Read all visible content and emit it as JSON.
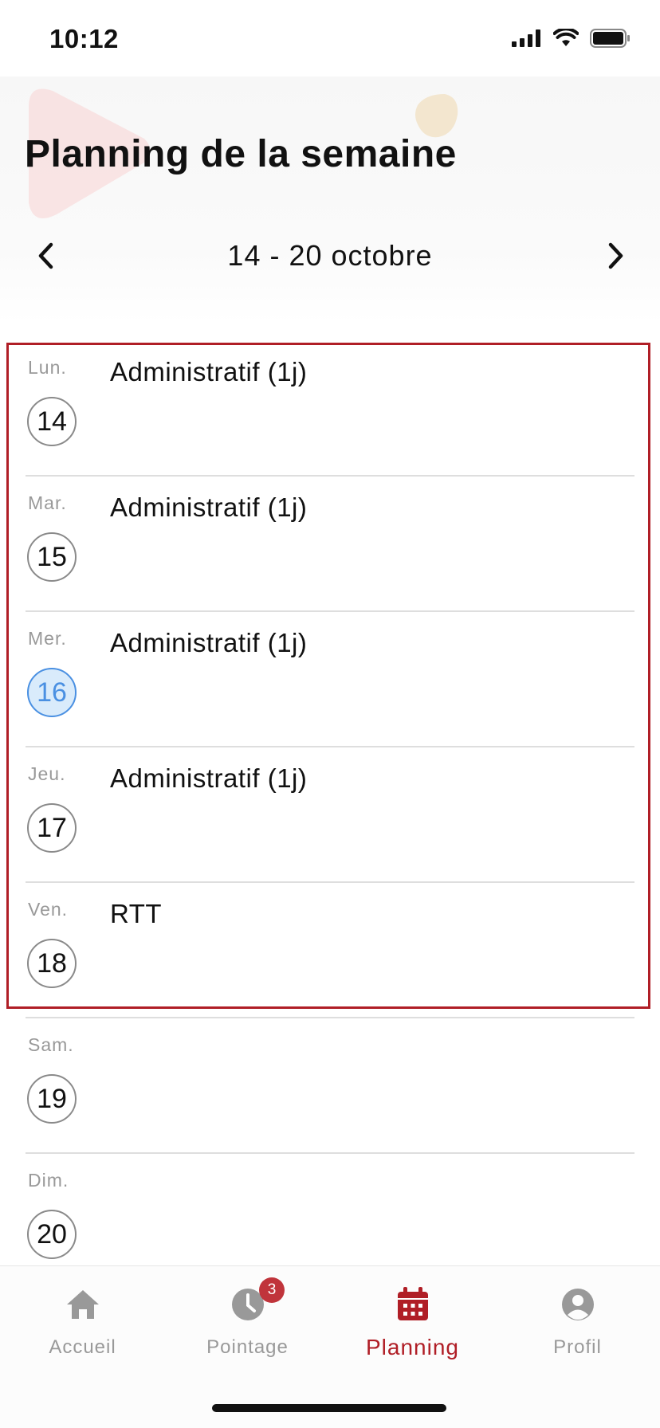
{
  "status_bar": {
    "time": "10:12"
  },
  "header": {
    "title": "Planning de la semaine",
    "week_range": "14 - 20 octobre"
  },
  "days": [
    {
      "abbr": "Lun.",
      "number": "14",
      "event": "Administratif (1j)",
      "today": false
    },
    {
      "abbr": "Mar.",
      "number": "15",
      "event": "Administratif (1j)",
      "today": false
    },
    {
      "abbr": "Mer.",
      "number": "16",
      "event": "Administratif (1j)",
      "today": true
    },
    {
      "abbr": "Jeu.",
      "number": "17",
      "event": "Administratif (1j)",
      "today": false
    },
    {
      "abbr": "Ven.",
      "number": "18",
      "event": "RTT",
      "today": false
    },
    {
      "abbr": "Sam.",
      "number": "19",
      "event": "",
      "today": false
    },
    {
      "abbr": "Dim.",
      "number": "20",
      "event": "",
      "today": false
    }
  ],
  "tabs": [
    {
      "label": "Accueil",
      "icon": "home-icon",
      "active": false
    },
    {
      "label": "Pointage",
      "icon": "clock-icon",
      "active": false,
      "badge": "3"
    },
    {
      "label": "Planning",
      "icon": "calendar-icon",
      "active": true
    },
    {
      "label": "Profil",
      "icon": "user-icon",
      "active": false
    }
  ],
  "colors": {
    "accent": "#b01e26",
    "today": "#4a90e2",
    "today_bg": "#d9ebfb",
    "muted": "#999999"
  }
}
